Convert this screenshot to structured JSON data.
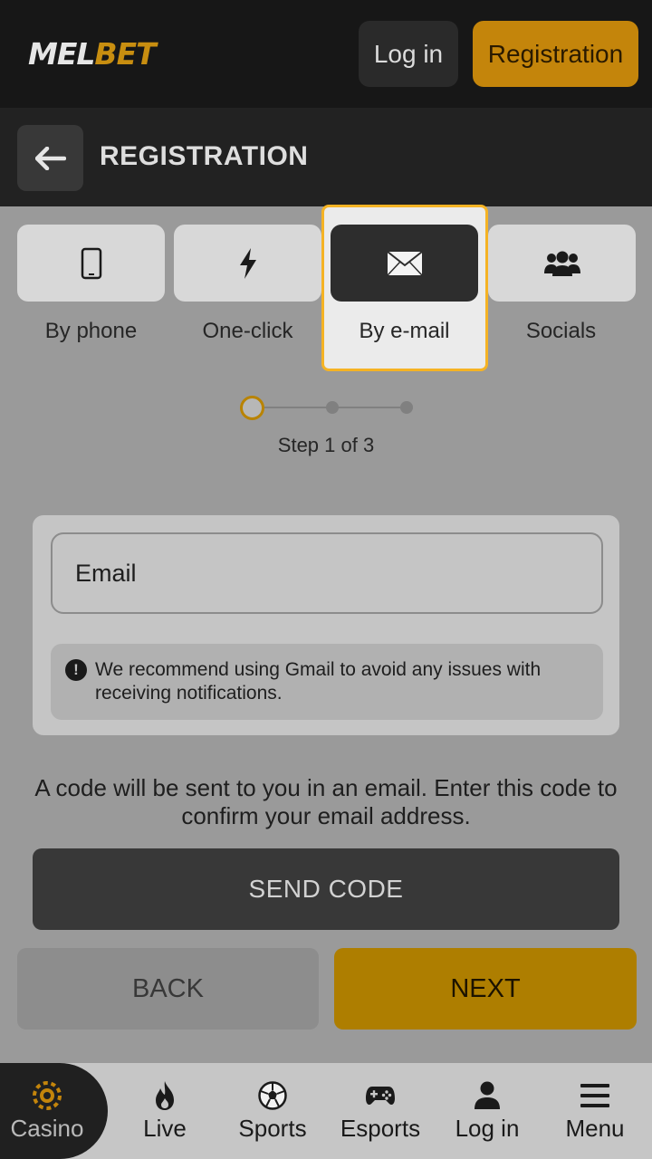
{
  "header": {
    "logo_part1": "MEL",
    "logo_part2": "BET",
    "login_label": "Log in",
    "registration_label": "Registration"
  },
  "titlebar": {
    "back_icon": "arrow-left-icon",
    "title": "REGISTRATION"
  },
  "methods": [
    {
      "label": "By phone",
      "icon": "phone-icon",
      "selected": false
    },
    {
      "label": "One-click",
      "icon": "lightning-icon",
      "selected": false
    },
    {
      "label": "By e-mail",
      "icon": "envelope-icon",
      "selected": true
    },
    {
      "label": "Socials",
      "icon": "people-icon",
      "selected": false
    }
  ],
  "stepper": {
    "current": 1,
    "total": 3,
    "text": "Step 1 of 3"
  },
  "form": {
    "email_placeholder": "Email",
    "email_value": "",
    "notice_text": "We recommend using Gmail to avoid any issues with receiving notifications."
  },
  "info_text": "A code will be sent to you in an email. Enter this code to confirm your email address.",
  "buttons": {
    "send_code": "SEND CODE",
    "back": "BACK",
    "next": "NEXT"
  },
  "bottom_nav": [
    {
      "label": "Casino",
      "icon": "casino-chip-icon",
      "active": true
    },
    {
      "label": "Live",
      "icon": "flame-icon",
      "active": false
    },
    {
      "label": "Sports",
      "icon": "soccer-ball-icon",
      "active": false
    },
    {
      "label": "Esports",
      "icon": "gamepad-icon",
      "active": false
    },
    {
      "label": "Log in",
      "icon": "user-icon",
      "active": false
    },
    {
      "label": "Menu",
      "icon": "hamburger-menu-icon",
      "active": false
    }
  ],
  "colors": {
    "accent": "#c4850b",
    "selected_outline": "#f5b324",
    "header_bg": "#171717"
  }
}
